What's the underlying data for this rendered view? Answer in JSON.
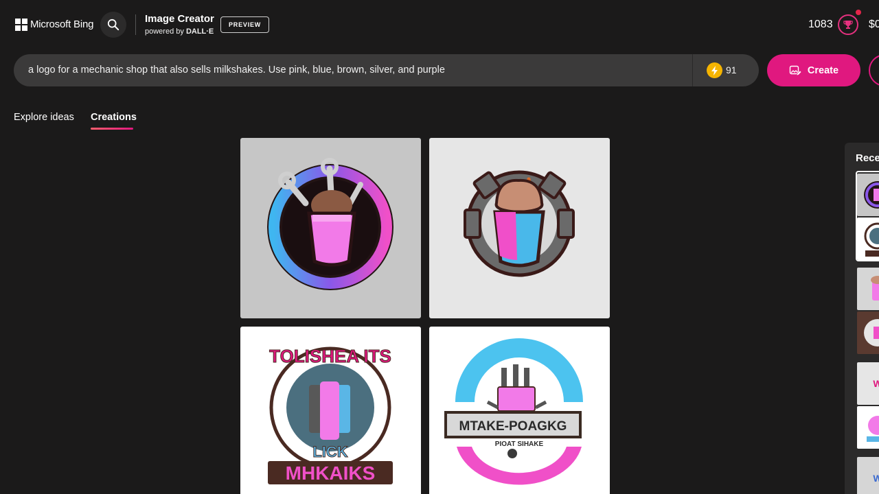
{
  "header": {
    "brand": "Microsoft Bing",
    "app_title": "Image Creator",
    "app_sub_prefix": "powered by ",
    "app_sub_strong": "DALL·E",
    "preview_badge": "PREVIEW",
    "points": "1083",
    "currency": "$0"
  },
  "prompt": {
    "value": "a logo for a mechanic shop that also sells milkshakes. Use pink, blue, brown, silver, and purple",
    "boosts": "91",
    "create_label": "Create"
  },
  "tabs": [
    {
      "label": "Explore ideas",
      "active": false
    },
    {
      "label": "Creations",
      "active": true
    }
  ],
  "images": [
    {
      "text": ""
    },
    {
      "text": ""
    },
    {
      "text_top": "TOLISHEA ITS",
      "text_mid": "LICK",
      "text_bottom": "MHKAIKS"
    },
    {
      "banner": "MTAKE-POAGKG",
      "sub": "PIOAT SIHAKE"
    }
  ],
  "recent": {
    "title": "Recent"
  },
  "colors": {
    "accent": "#e0187f",
    "background": "#1b1a1a",
    "prompt_bg": "#3b3a3a",
    "boost": "#f5b400"
  },
  "icons": {
    "search": "search-icon",
    "reward": "trophy-icon",
    "boost": "lightning-icon",
    "create": "image-edit-icon"
  }
}
